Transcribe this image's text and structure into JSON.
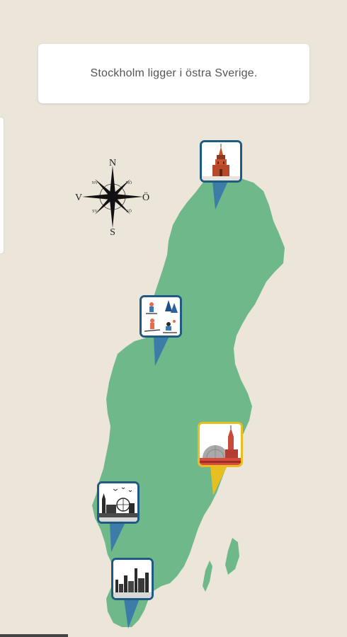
{
  "info": {
    "message": "Stockholm ligger i östra Sverige."
  },
  "compass": {
    "north": "N",
    "south": "S",
    "west": "V",
    "east": "Ö",
    "nw": "NV",
    "ne": "NÖ",
    "sw": "SV",
    "se": "SÖ"
  },
  "map": {
    "land_color": "#6fb88a",
    "background_color": "#ece5da"
  },
  "pins": [
    {
      "name": "kiruna",
      "icon": "church-tower-icon",
      "state": "default"
    },
    {
      "name": "jamtland",
      "icon": "winter-sports-icon",
      "state": "default"
    },
    {
      "name": "stockholm",
      "icon": "city-hall-globe-icon",
      "state": "selected"
    },
    {
      "name": "goteborg",
      "icon": "harbor-skyline-icon",
      "state": "default"
    },
    {
      "name": "malmo",
      "icon": "industrial-skyline-icon",
      "state": "default"
    }
  ],
  "colors": {
    "pin_border": "#1f5a83",
    "pin_selected": "#e7bf20",
    "pin_tail": "#3d7ca8"
  }
}
